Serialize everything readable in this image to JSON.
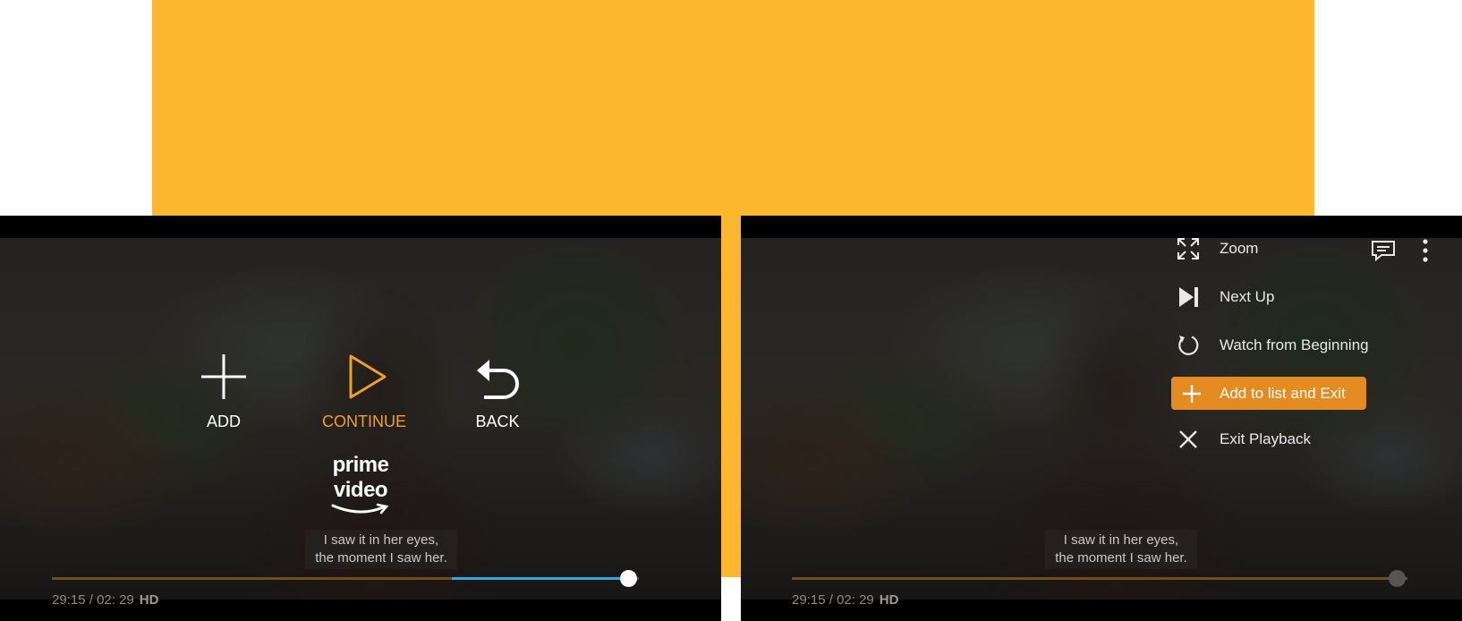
{
  "colors": {
    "banner": "#fdb72e",
    "accent_orange": "#f0a02a",
    "menu_highlight": "#e48b22",
    "progress_blue": "#2ea8e8",
    "progress_track": "#7a5a1e",
    "black": "#000000"
  },
  "left_screen": {
    "controls": [
      {
        "icon": "plus-icon",
        "label": "ADD"
      },
      {
        "icon": "play-icon",
        "label": "CONTINUE"
      },
      {
        "icon": "back-arrow-icon",
        "label": "BACK"
      }
    ],
    "brand": {
      "text": "prime video"
    },
    "subtitle": {
      "line1": "I saw it in her eyes,",
      "line2": "the moment I saw her."
    },
    "time": {
      "current": "29:15",
      "separator": " / ",
      "total": "02: 29",
      "quality": "HD"
    },
    "progress": {
      "played_fraction": 0.682,
      "buffer_end_fraction": 0.981
    }
  },
  "right_screen": {
    "top_icons": [
      "subtitles-icon",
      "more-vertical-icon"
    ],
    "menu": [
      {
        "icon": "zoom-icon",
        "label": "Zoom",
        "highlighted": false
      },
      {
        "icon": "next-up-icon",
        "label": "Next Up",
        "highlighted": false
      },
      {
        "icon": "restart-icon",
        "label": "Watch from Beginning",
        "highlighted": false
      },
      {
        "icon": "plus-icon",
        "label": "Add to list and Exit",
        "highlighted": true
      },
      {
        "icon": "close-icon",
        "label": "Exit Playback",
        "highlighted": false
      }
    ],
    "subtitle": {
      "line1": "I saw it in her eyes,",
      "line2": "the moment I saw her."
    },
    "time": {
      "current": "29:15",
      "separator": " / ",
      "total": "02: 29",
      "quality": "HD"
    },
    "progress": {
      "played_fraction": 0.982
    }
  }
}
